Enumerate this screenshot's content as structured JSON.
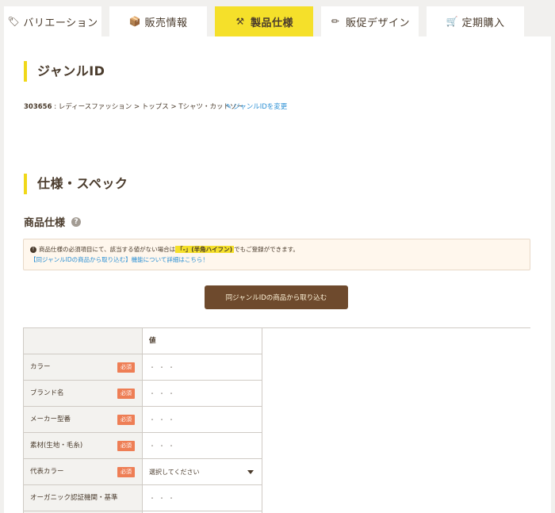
{
  "tabs": [
    {
      "label": "バリエーション",
      "icon": "tag-icon"
    },
    {
      "label": "販売情報",
      "icon": "box-icon"
    },
    {
      "label": "製品仕様",
      "icon": "tools-icon",
      "active": true
    },
    {
      "label": "販促デザイン",
      "icon": "pencil-icon"
    },
    {
      "label": "定期購入",
      "icon": "cart-icon"
    }
  ],
  "genre_section": {
    "title": "ジャンルID",
    "genre_id": "303656",
    "genre_path": "レディースファッション > トップス > Tシャツ・カットソー",
    "change_link": "ジャンルIDを変更"
  },
  "spec_section": {
    "title": "仕様・スペック",
    "subtitle": "商品仕様",
    "help_icon": "?",
    "notice": {
      "text_before": "商品仕様の必須項目にて、該当する値がない場合は",
      "highlight": "「-」(半角ハイフン)",
      "text_after": "でもご登録ができます。",
      "link": "【同ジャンルIDの商品から取り込む】機能について詳細はこちら！"
    },
    "import_button": "同ジャンルIDの商品から取り込む",
    "table": {
      "header_value": "値",
      "required_label": "必須",
      "rows": [
        {
          "label": "カラー",
          "required": true,
          "value": "・・・"
        },
        {
          "label": "ブランド名",
          "required": true,
          "value": "・・・"
        },
        {
          "label": "メーカー型番",
          "required": true,
          "value": "・・・"
        },
        {
          "label": "素材(生地・毛糸)",
          "required": true,
          "value": "・・・"
        },
        {
          "label": "代表カラー",
          "required": true,
          "value": "選択してください"
        },
        {
          "label": "オーガニック認証機関・基準",
          "required": false,
          "value": "・・・"
        }
      ]
    }
  },
  "colors": {
    "accent_yellow": "#f5e02a",
    "brown_button": "#6e4a2d",
    "required_badge": "#ee7e55",
    "link_blue": "#2a8fd4"
  }
}
